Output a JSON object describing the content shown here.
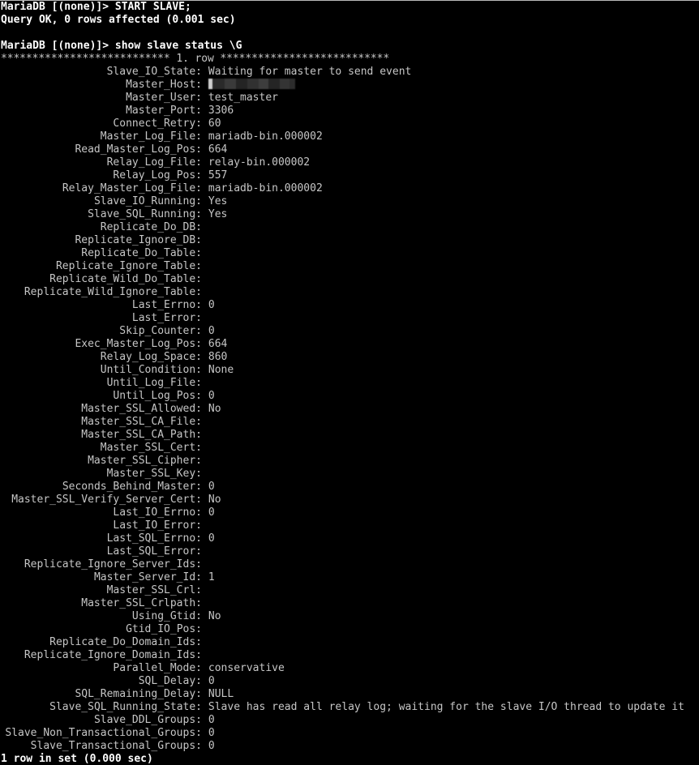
{
  "terminal": {
    "background_color": "#000000",
    "text_color": "#c6c6c6",
    "bright_text_color": "#ffffff"
  },
  "session": {
    "prompt": "MariaDB [(none)]>",
    "command_1": "MariaDB [(none)]> START SLAVE;",
    "result_1": "Query OK, 0 rows affected (0.001 sec)",
    "command_2": "MariaDB [(none)]> show slave status \\G",
    "row_separator": "*************************** 1. row ***************************",
    "footer": "1 row in set (0.000 sec)"
  },
  "status_fields": [
    {
      "name": "Slave_IO_State",
      "value": "Waiting for master to send event"
    },
    {
      "name": "Master_Host",
      "value": "",
      "redacted": true
    },
    {
      "name": "Master_User",
      "value": "test_master"
    },
    {
      "name": "Master_Port",
      "value": "3306"
    },
    {
      "name": "Connect_Retry",
      "value": "60"
    },
    {
      "name": "Master_Log_File",
      "value": "mariadb-bin.000002"
    },
    {
      "name": "Read_Master_Log_Pos",
      "value": "664"
    },
    {
      "name": "Relay_Log_File",
      "value": "relay-bin.000002"
    },
    {
      "name": "Relay_Log_Pos",
      "value": "557"
    },
    {
      "name": "Relay_Master_Log_File",
      "value": "mariadb-bin.000002"
    },
    {
      "name": "Slave_IO_Running",
      "value": "Yes"
    },
    {
      "name": "Slave_SQL_Running",
      "value": "Yes"
    },
    {
      "name": "Replicate_Do_DB",
      "value": ""
    },
    {
      "name": "Replicate_Ignore_DB",
      "value": ""
    },
    {
      "name": "Replicate_Do_Table",
      "value": ""
    },
    {
      "name": "Replicate_Ignore_Table",
      "value": ""
    },
    {
      "name": "Replicate_Wild_Do_Table",
      "value": ""
    },
    {
      "name": "Replicate_Wild_Ignore_Table",
      "value": ""
    },
    {
      "name": "Last_Errno",
      "value": "0"
    },
    {
      "name": "Last_Error",
      "value": ""
    },
    {
      "name": "Skip_Counter",
      "value": "0"
    },
    {
      "name": "Exec_Master_Log_Pos",
      "value": "664"
    },
    {
      "name": "Relay_Log_Space",
      "value": "860"
    },
    {
      "name": "Until_Condition",
      "value": "None"
    },
    {
      "name": "Until_Log_File",
      "value": ""
    },
    {
      "name": "Until_Log_Pos",
      "value": "0"
    },
    {
      "name": "Master_SSL_Allowed",
      "value": "No"
    },
    {
      "name": "Master_SSL_CA_File",
      "value": ""
    },
    {
      "name": "Master_SSL_CA_Path",
      "value": ""
    },
    {
      "name": "Master_SSL_Cert",
      "value": ""
    },
    {
      "name": "Master_SSL_Cipher",
      "value": ""
    },
    {
      "name": "Master_SSL_Key",
      "value": ""
    },
    {
      "name": "Seconds_Behind_Master",
      "value": "0"
    },
    {
      "name": "Master_SSL_Verify_Server_Cert",
      "value": "No"
    },
    {
      "name": "Last_IO_Errno",
      "value": "0"
    },
    {
      "name": "Last_IO_Error",
      "value": ""
    },
    {
      "name": "Last_SQL_Errno",
      "value": "0"
    },
    {
      "name": "Last_SQL_Error",
      "value": ""
    },
    {
      "name": "Replicate_Ignore_Server_Ids",
      "value": ""
    },
    {
      "name": "Master_Server_Id",
      "value": "1"
    },
    {
      "name": "Master_SSL_Crl",
      "value": ""
    },
    {
      "name": "Master_SSL_Crlpath",
      "value": ""
    },
    {
      "name": "Using_Gtid",
      "value": "No"
    },
    {
      "name": "Gtid_IO_Pos",
      "value": ""
    },
    {
      "name": "Replicate_Do_Domain_Ids",
      "value": ""
    },
    {
      "name": "Replicate_Ignore_Domain_Ids",
      "value": ""
    },
    {
      "name": "Parallel_Mode",
      "value": "conservative"
    },
    {
      "name": "SQL_Delay",
      "value": "0"
    },
    {
      "name": "SQL_Remaining_Delay",
      "value": "NULL"
    },
    {
      "name": "Slave_SQL_Running_State",
      "value": "Slave has read all relay log; waiting for the slave I/O thread to update it"
    },
    {
      "name": "Slave_DDL_Groups",
      "value": "0"
    },
    {
      "name": "Slave_Non_Transactional_Groups",
      "value": "0"
    },
    {
      "name": "Slave_Transactional_Groups",
      "value": "0"
    }
  ]
}
